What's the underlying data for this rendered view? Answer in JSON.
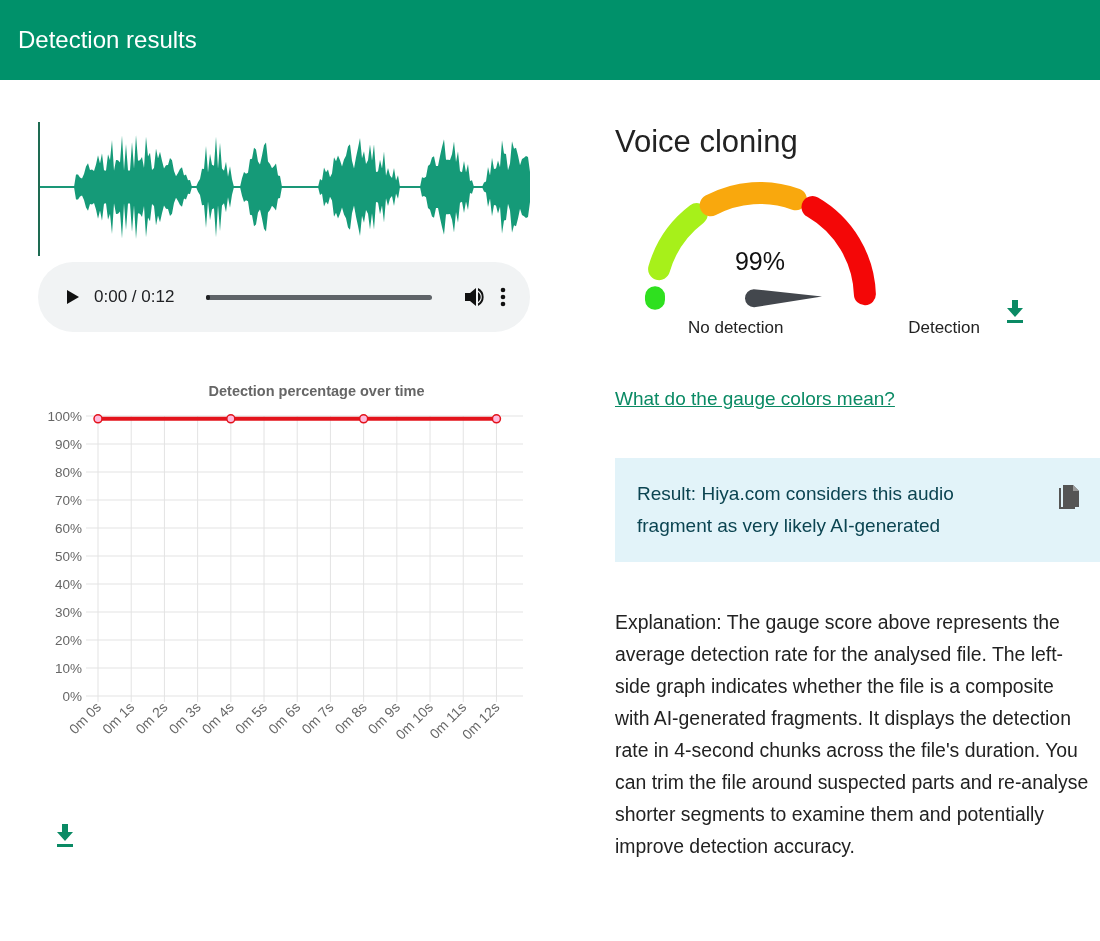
{
  "header": {
    "title": "Detection results"
  },
  "player": {
    "time": "0:00 / 0:12",
    "level": 0
  },
  "chart": {
    "chart_data": {
      "type": "line",
      "title": "Detection percentage over time",
      "categories": [
        "0m 0s",
        "0m 1s",
        "0m 2s",
        "0m 3s",
        "0m 4s",
        "0m 5s",
        "0m 6s",
        "0m 7s",
        "0m 8s",
        "0m 9s",
        "0m 10s",
        "0m 11s",
        "0m 12s"
      ],
      "grid": true,
      "series": [
        {
          "color": "#e3131b",
          "marker": true,
          "values": [
            99,
            null,
            null,
            null,
            99,
            null,
            null,
            null,
            99,
            null,
            null,
            null,
            99
          ]
        }
      ],
      "ylim": [
        0,
        100
      ],
      "yticks": [
        {
          "value": 0,
          "label": "0%"
        },
        {
          "value": 10,
          "label": "10%"
        },
        {
          "value": 20,
          "label": "20%"
        },
        {
          "value": 30,
          "label": "30%"
        },
        {
          "value": 40,
          "label": "40%"
        },
        {
          "value": 50,
          "label": "50%"
        },
        {
          "value": 60,
          "label": "60%"
        },
        {
          "value": 70,
          "label": "70%"
        },
        {
          "value": 80,
          "label": "80%"
        },
        {
          "value": 90,
          "label": "90%"
        },
        {
          "value": 100,
          "label": "100%"
        }
      ]
    }
  },
  "analysis": {
    "title": "Voice cloning",
    "gauge": {
      "reading": "99%",
      "min_label": "No detection",
      "max_label": "Detection"
    },
    "link": "What do the gauge colors mean?",
    "result": "Result: Hiya.com considers this audio fragment as very likely AI-generated",
    "explanation": "Explanation: The gauge score above represents the average detection rate for the analysed file. The left-side graph indicates whether the file is a composite with AI-generated fragments. It displays the detection rate in 4-second chunks across the file's duration. You can trim the file around suspected parts and re-analyse shorter segments to examine them and potentially improve detection accuracy."
  }
}
